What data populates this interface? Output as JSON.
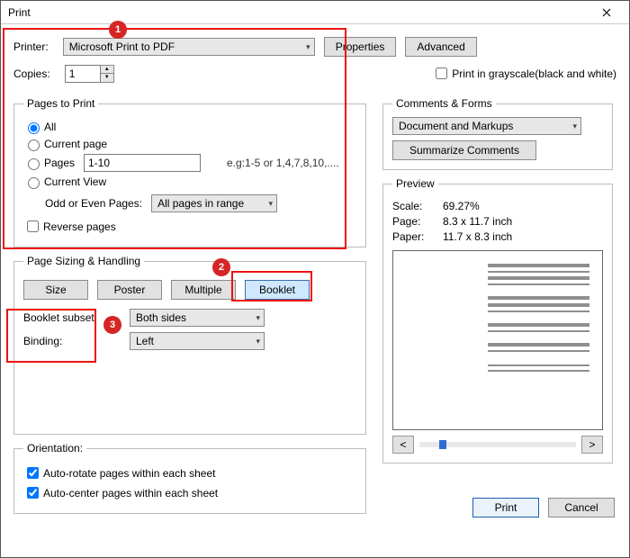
{
  "title": "Print",
  "printer": {
    "label": "Printer:",
    "value": "Microsoft Print to PDF"
  },
  "copies": {
    "label": "Copies:",
    "value": "1"
  },
  "buttons": {
    "properties": "Properties",
    "advanced": "Advanced",
    "summarize": "Summarize Comments",
    "print": "Print",
    "cancel": "Cancel"
  },
  "grayscale": {
    "label": "Print in grayscale(black and white)"
  },
  "pagesToPrint": {
    "legend": "Pages to Print",
    "all": "All",
    "current": "Current page",
    "pages": "Pages",
    "pages_value": "1-10",
    "pages_hint": "e.g:1-5 or 1,4,7,8,10,....",
    "view": "Current View",
    "oddeven_label": "Odd or Even Pages:",
    "oddeven_value": "All pages in range",
    "reverse": "Reverse pages"
  },
  "sizing": {
    "legend": "Page Sizing & Handling",
    "size": "Size",
    "poster": "Poster",
    "multiple": "Multiple",
    "booklet": "Booklet",
    "subset_label": "Booklet subset:",
    "subset_value": "Both sides",
    "binding_label": "Binding:",
    "binding_value": "Left"
  },
  "comments": {
    "legend": "Comments & Forms",
    "value": "Document and Markups"
  },
  "preview": {
    "legend": "Preview",
    "scale_label": "Scale:",
    "scale_value": "69.27%",
    "page_label": "Page:",
    "page_value": "8.3 x 11.7 inch",
    "paper_label": "Paper:",
    "paper_value": "11.7 x 8.3 inch",
    "prev": "<",
    "next": ">"
  },
  "orientation": {
    "legend": "Orientation:",
    "auto_rotate": "Auto-rotate pages within each sheet",
    "auto_center": "Auto-center pages within each sheet"
  },
  "callouts": {
    "b1": "1",
    "b2": "2",
    "b3": "3"
  }
}
